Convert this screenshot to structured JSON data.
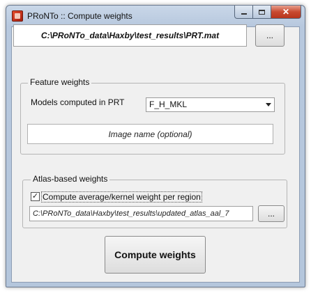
{
  "window": {
    "title": "PRoNTo :: Compute weights"
  },
  "prt_file": {
    "path": "C:\\PRoNTo_data\\Haxby\\test_results\\PRT.mat",
    "browse_label": "..."
  },
  "feature_weights": {
    "legend": "Feature weights",
    "models_label": "Models computed in PRT",
    "selected_model": "F_H_MKL",
    "image_name_placeholder": "Image name (optional)"
  },
  "atlas_weights": {
    "legend": "Atlas-based weights",
    "checkbox_label": "Compute average/kernel weight per region",
    "checked": true,
    "atlas_path": "C:\\PRoNTo_data\\Haxby\\test_results\\updated_atlas_aal_7",
    "browse_label": "..."
  },
  "actions": {
    "compute_label": "Compute weights"
  },
  "icons": {
    "app": "pronto-app-icon",
    "minimize": "minimize-icon",
    "maximize": "maximize-icon",
    "close": "close-icon",
    "dropdown": "chevron-down-icon",
    "check": "check-icon"
  },
  "colors": {
    "close_button": "#c84a30",
    "frame": "#b7c8de",
    "client": "#f0f0f0"
  }
}
